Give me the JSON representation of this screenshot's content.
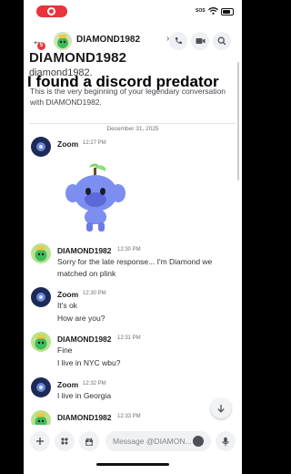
{
  "status_bar": {
    "carrier": "SOS"
  },
  "header": {
    "title": "DIAMOND1982",
    "badge_count": "5"
  },
  "intro": {
    "title": "DIAMOND1982",
    "username": "diamond1982.",
    "text": "This is the very beginning of your legendary conversation with DIAMOND1982."
  },
  "overlay_caption": "I found a discord predator",
  "date_divider": "December 31, 2025",
  "messages": [
    {
      "author": "Zoom",
      "time": "12:27 PM",
      "lines": []
    },
    {
      "author": "DIAMOND1982",
      "time": "12:30 PM",
      "lines": [
        "Sorry for the late response... I'm Diamond we",
        "matched on plink"
      ]
    },
    {
      "author": "Zoom",
      "time": "12:30 PM",
      "lines": [
        "It's ok",
        "How are you?"
      ]
    },
    {
      "author": "DIAMOND1982",
      "time": "12:31 PM",
      "lines": [
        "Fine",
        "I live in NYC wbu?"
      ]
    },
    {
      "author": "Zoom",
      "time": "12:32 PM",
      "lines": [
        "I live in Georgia"
      ]
    },
    {
      "author": "DIAMOND1982",
      "time": "12:33 PM",
      "lines": []
    }
  ],
  "composer": {
    "placeholder": "Message @DIAMON..."
  },
  "colors": {
    "accent": "#5865f2",
    "notification": "#e5393e",
    "recording": "#e8343a"
  }
}
